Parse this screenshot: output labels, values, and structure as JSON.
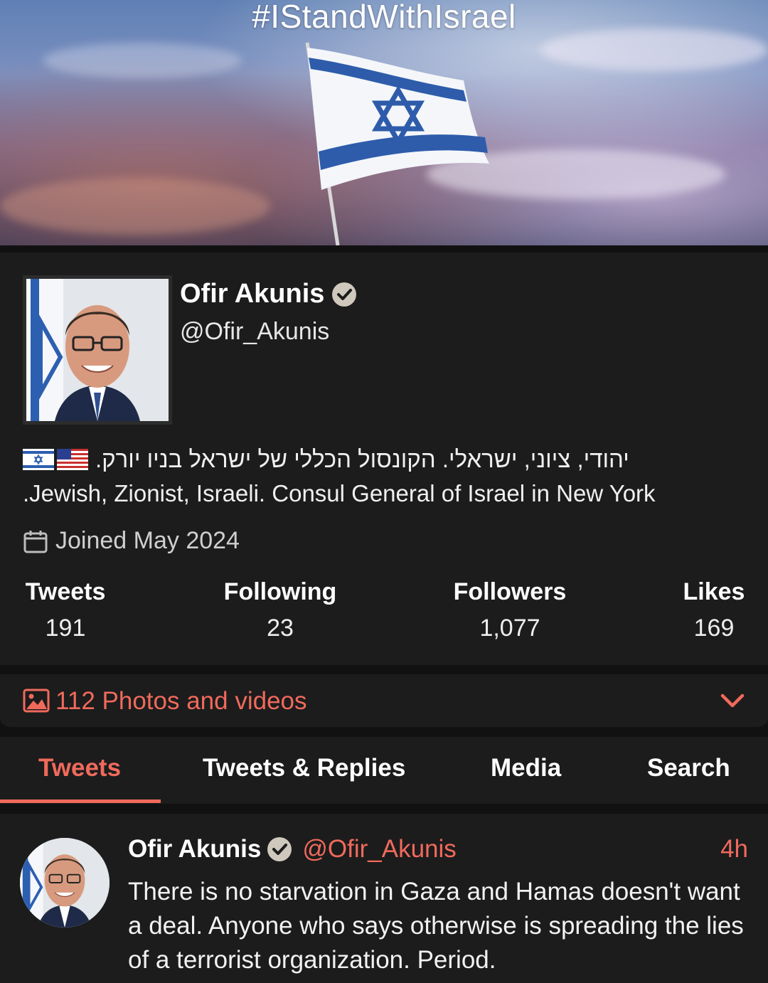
{
  "banner": {
    "hashtag": "#IStandWithIsrael"
  },
  "profile": {
    "display_name": "Ofir Akunis",
    "handle": "@Ofir_Akunis",
    "verified": true,
    "bio_hebrew": "יהודי, ציוני, ישראלי. הקונסול הכללי של ישראל בניו יורק.",
    "bio_english": ".Jewish, Zionist, Israeli. Consul  General of Israel in New York",
    "joined": "Joined May 2024"
  },
  "stats": {
    "tweets_label": "Tweets",
    "tweets_value": "191",
    "following_label": "Following",
    "following_value": "23",
    "followers_label": "Followers",
    "followers_value": "1,077",
    "likes_label": "Likes",
    "likes_value": "169"
  },
  "media": {
    "photos_label": "112 Photos and videos"
  },
  "tabs": [
    {
      "label": "Tweets",
      "active": true
    },
    {
      "label": "Tweets & Replies",
      "active": false
    },
    {
      "label": "Media",
      "active": false
    },
    {
      "label": "Search",
      "active": false
    }
  ],
  "tweet": {
    "name": "Ofir Akunis",
    "handle": "@Ofir_Akunis",
    "time": "4h",
    "text": "There is no starvation in Gaza and Hamas doesn't want a deal. Anyone who says otherwise is spreading the lies of a terrorist organization. Period."
  },
  "colors": {
    "accent": "#f06a5c",
    "background": "#111111",
    "card": "#1c1c1c"
  },
  "icons": [
    "verified-badge-icon",
    "calendar-icon",
    "photos-icon",
    "chevron-down-icon",
    "israel-flag-icon",
    "us-flag-icon"
  ]
}
